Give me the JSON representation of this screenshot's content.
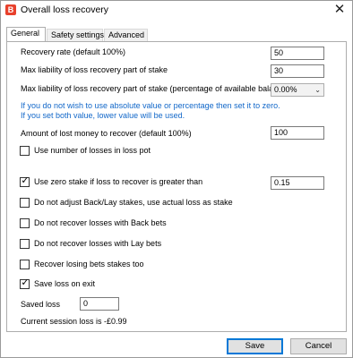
{
  "window": {
    "title": "Overall loss recovery",
    "app_icon_letter": "B",
    "close_glyph": "✕"
  },
  "tabs": [
    {
      "label": "General",
      "active": true
    },
    {
      "label": "Safety settings",
      "active": false
    },
    {
      "label": "Advanced",
      "active": false
    }
  ],
  "general": {
    "recovery_rate": {
      "label": "Recovery rate (default 100%)",
      "value": "50"
    },
    "max_liability": {
      "label": "Max liability of loss recovery part of stake",
      "value": "30"
    },
    "max_liability_pct": {
      "label": "Max liability of loss recovery part of stake (percentage of available balance)",
      "value": "0.00%"
    },
    "info_line1": "If you do not wish to use absolute value or percentage then set it to zero.",
    "info_line2": "If you set both value, lower value will be used.",
    "amount_lost": {
      "label": "Amount of lost money to recover (default 100%)",
      "value": "100"
    },
    "use_number_losses": {
      "label": "Use number of losses in loss pot",
      "checked": false
    },
    "use_zero_stake": {
      "label": "Use zero stake if loss to recover is greater than",
      "checked": true,
      "value": "0.15"
    },
    "no_adjust": {
      "label": "Do not adjust Back/Lay stakes, use actual loss as stake",
      "checked": false
    },
    "no_recover_back": {
      "label": "Do not recover losses with Back bets",
      "checked": false
    },
    "no_recover_lay": {
      "label": "Do not recover losses with Lay bets",
      "checked": false
    },
    "recover_losing": {
      "label": "Recover losing bets stakes too",
      "checked": false
    },
    "save_loss": {
      "label": "Save loss on exit",
      "checked": true
    },
    "saved_loss": {
      "label": "Saved loss",
      "value": "0"
    },
    "current_session": "Current session loss is -£0.99"
  },
  "buttons": {
    "save": "Save",
    "cancel": "Cancel"
  }
}
